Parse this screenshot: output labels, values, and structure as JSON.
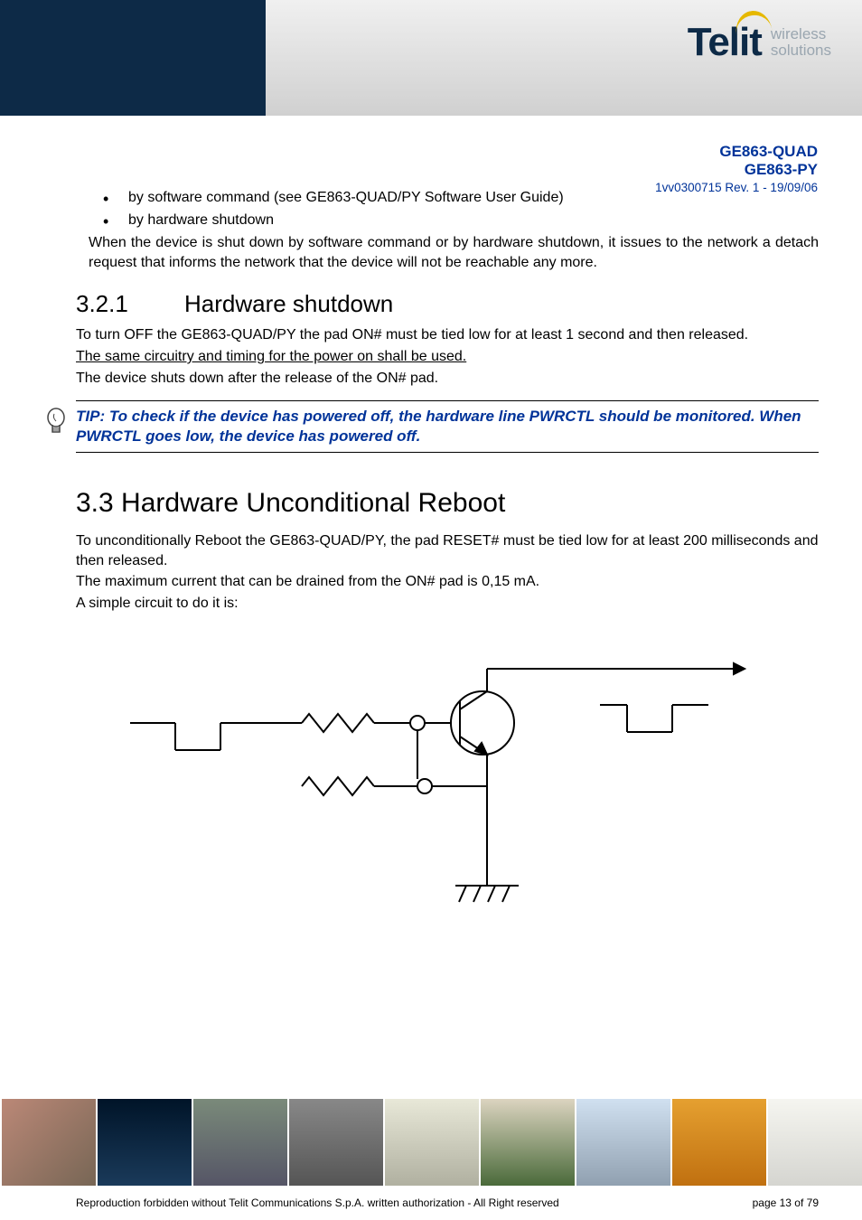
{
  "logo": {
    "brand": "Telit",
    "subline1": "wireless",
    "subline2": "solutions"
  },
  "doc_info": {
    "line1": "GE863-QUAD",
    "line2": "GE863-PY",
    "line3": "1vv0300715 Rev. 1 - 19/09/06"
  },
  "bullets": {
    "b1": "by software command (see GE863-QUAD/PY Software User Guide)",
    "b2": "by hardware shutdown"
  },
  "para_after_bullets": "When the device is shut down by software command or by hardware shutdown, it issues to the network a detach request that informs the network that the device will not be reachable any more.",
  "sec321": {
    "num": "3.2.1",
    "title": "Hardware shutdown",
    "p1": "To turn OFF the GE863-QUAD/PY the pad ON# must be tied low for at least 1 second and then released.",
    "p2": "The same circuitry and timing for the power on shall be used.",
    "p3": "The device shuts down after the release of the ON# pad."
  },
  "tip": "TIP: To check if the device has powered off, the hardware line PWRCTL should be monitored. When PWRCTL goes low, the device has powered off.",
  "sec33": {
    "num_title": "3.3 Hardware Unconditional Reboot",
    "p1": "To unconditionally Reboot the GE863-QUAD/PY, the pad RESET# must be tied low for at least 200 milliseconds and then released.",
    "p2": "The maximum current that can be drained from the ON# pad is 0,15 mA.",
    "p3": "A simple circuit to do it is:"
  },
  "footer": {
    "left": "Reproduction forbidden without Telit Communications S.p.A. written authorization - All Right reserved",
    "right": "page 13 of 79"
  }
}
